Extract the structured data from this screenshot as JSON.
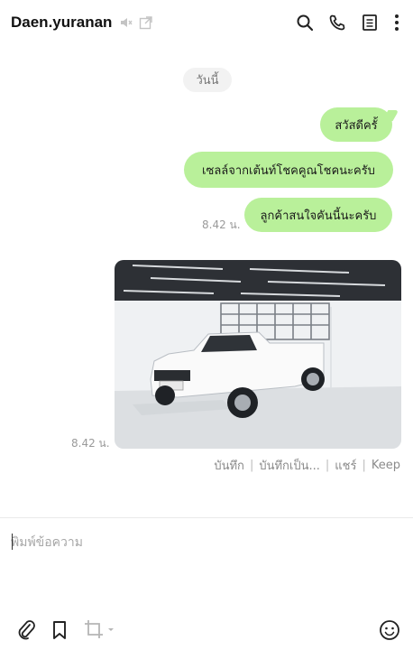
{
  "header": {
    "title": "Daen.yuranan",
    "icons": [
      "speaker-muted-icon",
      "popout-window-icon",
      "search-icon",
      "phone-call-icon",
      "notes-list-icon",
      "more-vertical-icon"
    ]
  },
  "chat": {
    "date_chip": "วันนี้",
    "messages": [
      {
        "text": "สวัสดีครั้"
      },
      {
        "text": "เซลล์จากเต้นท์โชคคูณโชคนะครับ"
      },
      {
        "text": "ลูกค้าสนใจคันนี้นะครับ"
      }
    ],
    "text_time": "8.42 น.",
    "photo_time": "8.42 น.",
    "photo_actions": [
      "บันทึก",
      "บันทึกเป็น...",
      "แชร์",
      "Keep"
    ]
  },
  "composer": {
    "placeholder": "พิมพ์ข้อความ",
    "icons": [
      "paperclip-icon",
      "bookmark-icon",
      "crop-icon",
      "emoji-icon"
    ]
  },
  "colors": {
    "bubble": "#b9f09a",
    "background": "#ffffff",
    "muted_text": "#9a9a9a"
  }
}
